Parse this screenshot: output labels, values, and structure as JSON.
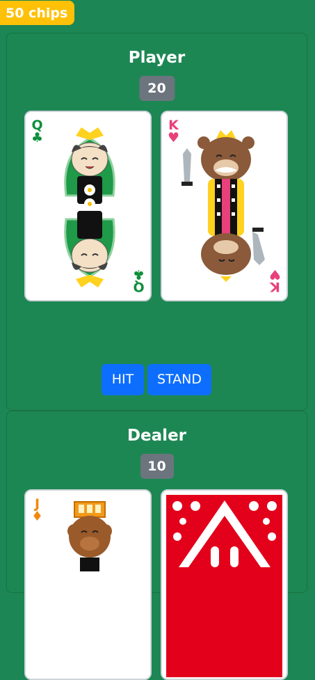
{
  "chips_label": "50 chips",
  "player": {
    "title": "Player",
    "score": "20",
    "cards": [
      {
        "rank": "Q",
        "suit": "♣",
        "suit_color": "#0f8f3c",
        "face": "queen-cat-icon"
      },
      {
        "rank": "K",
        "suit": "♥",
        "suit_color": "#e8407a",
        "face": "king-bear-icon"
      }
    ],
    "hit_label": "HIT",
    "stand_label": "STAND"
  },
  "dealer": {
    "title": "Dealer",
    "score": "10",
    "cards": [
      {
        "rank": "J",
        "suit": "♦",
        "suit_color": "#ef8a10",
        "face": "jack-dog-icon"
      },
      {
        "face": "card-back-icon"
      }
    ]
  },
  "colors": {
    "table": "#1c8654",
    "chips": "#ffc107",
    "score_badge": "#6c757d",
    "button": "#0d6efd",
    "card_back": "#e3001b"
  }
}
